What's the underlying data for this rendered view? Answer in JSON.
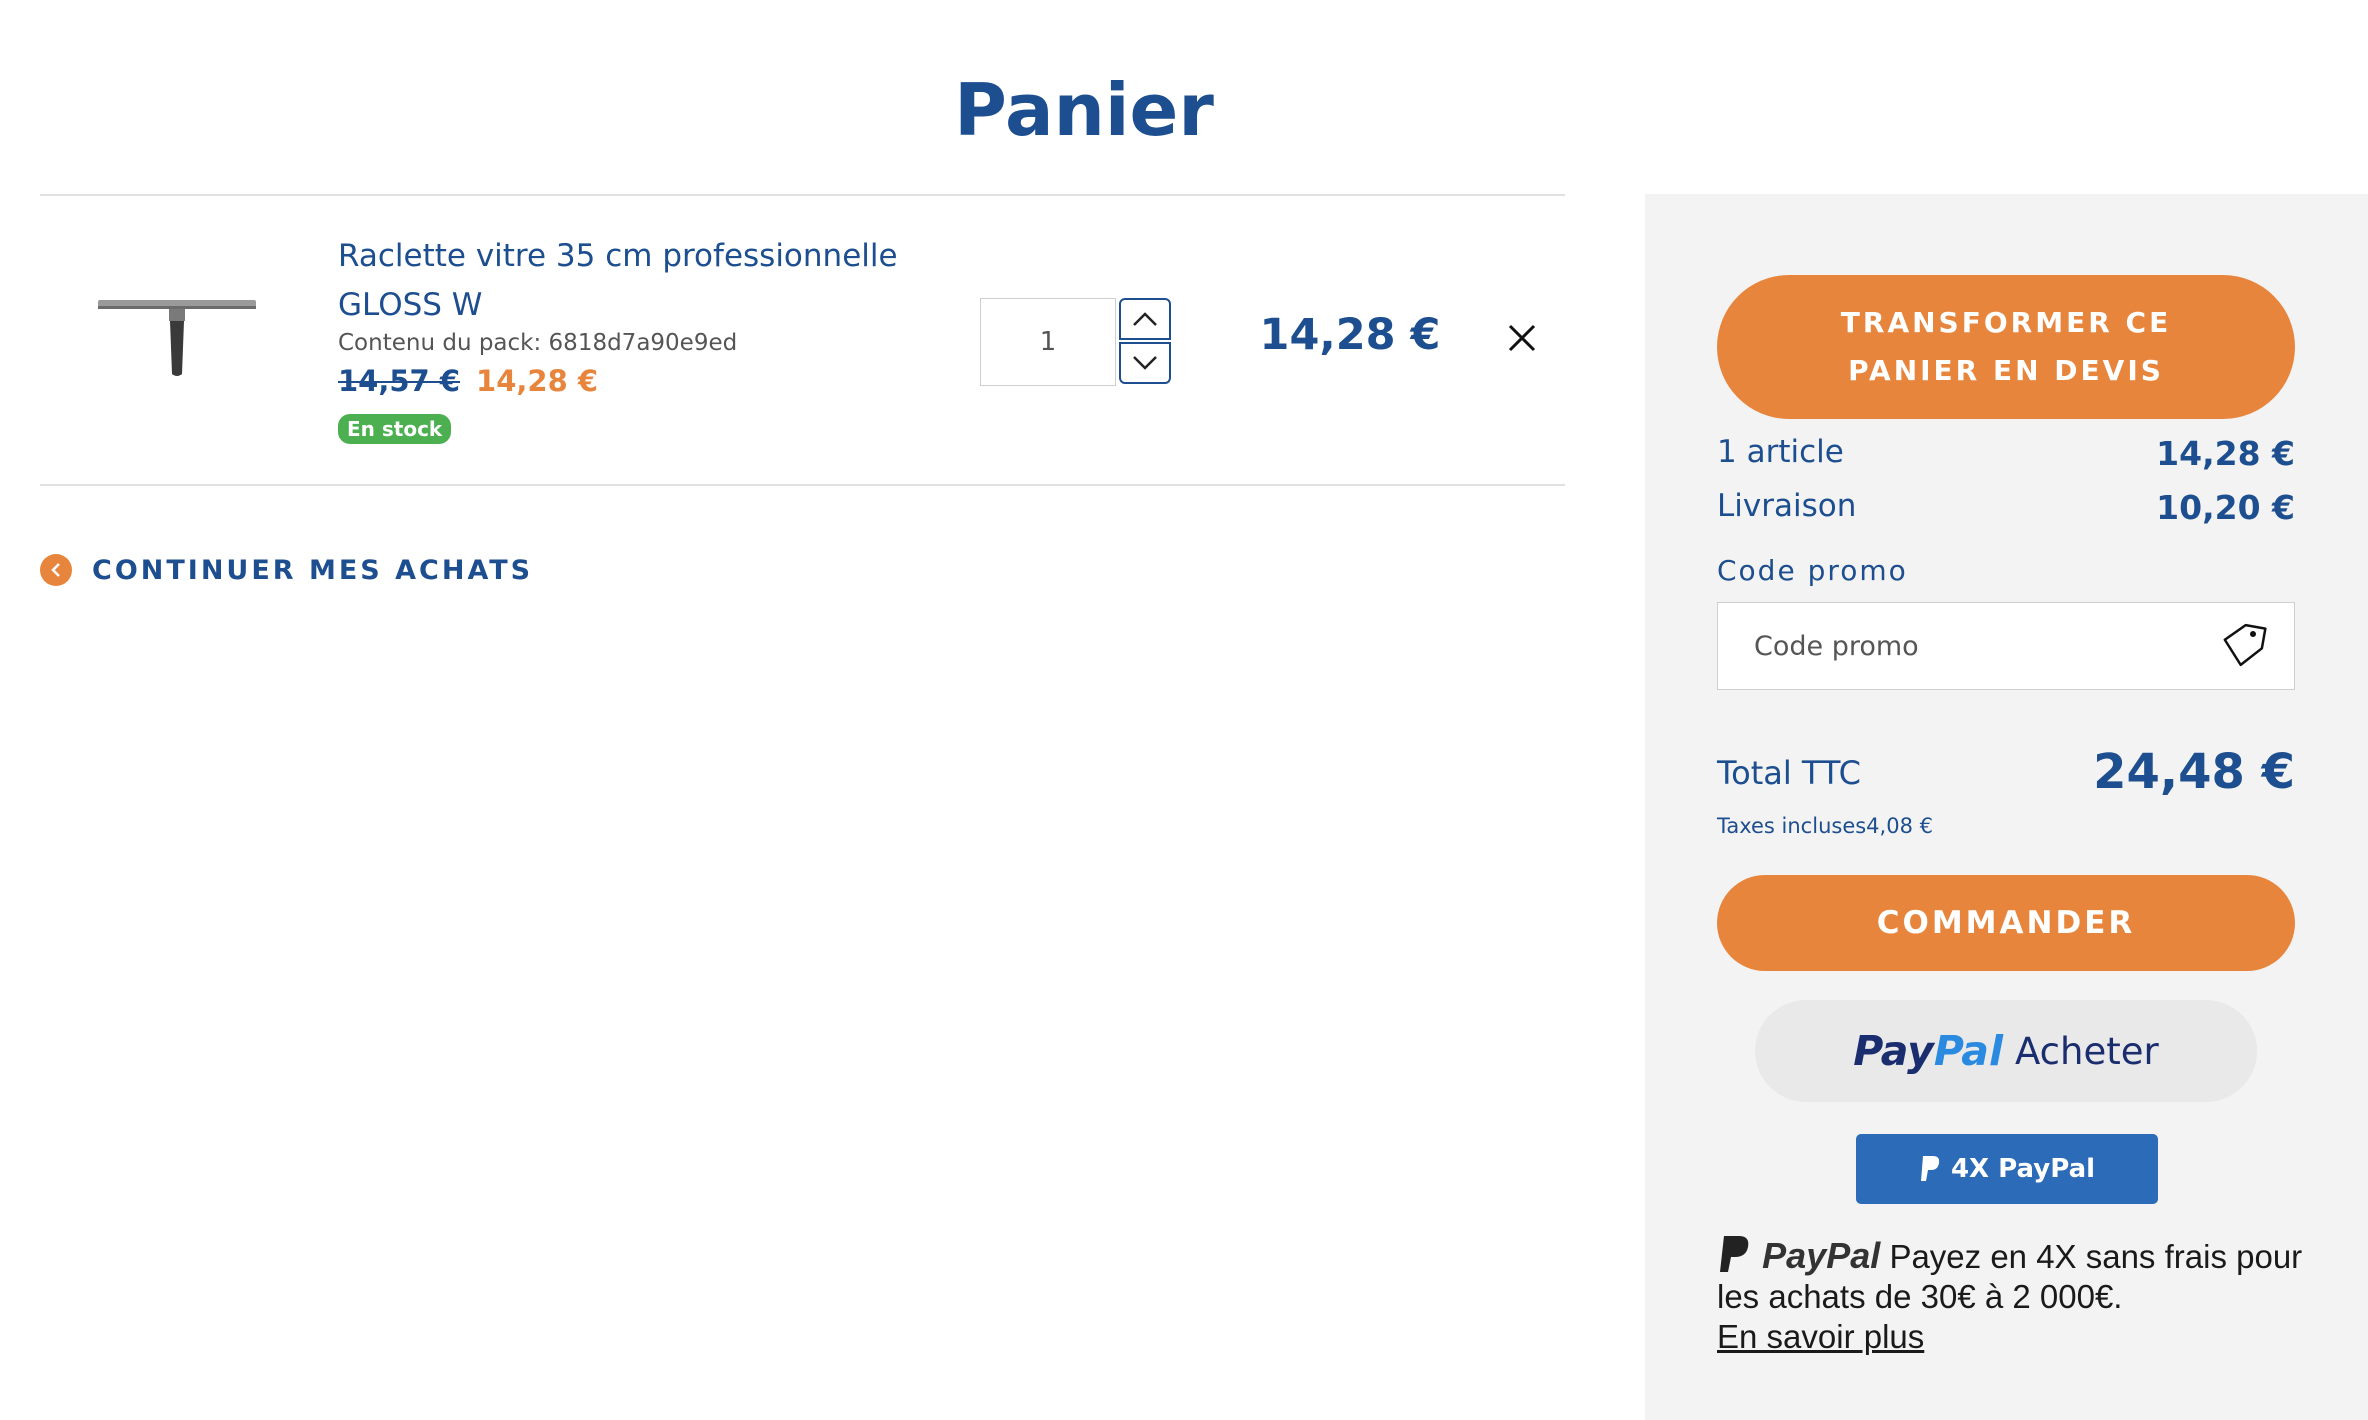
{
  "page": {
    "title": "Panier"
  },
  "cart": {
    "item": {
      "name": "Raclette vitre 35 cm professionnelle GLOSS W",
      "pack_content": "Contenu du pack: 6818d7a90e9ed",
      "old_price": "14,57 €",
      "price": "14,28 €",
      "stock": "En stock",
      "quantity": "1",
      "line_total": "14,28 €"
    },
    "continue_label": "CONTINUER MES ACHATS"
  },
  "summary": {
    "quote_button": "TRANSFORMER CE PANIER EN DEVIS",
    "articles_label": "1 article",
    "articles_value": "14,28 €",
    "shipping_label": "Livraison",
    "shipping_value": "10,20 €",
    "promo_label": "Code promo",
    "promo_placeholder": "Code promo",
    "total_label": "Total TTC",
    "total_value": "24,48 €",
    "tax_note": "Taxes incluses4,08 €",
    "order_button": "COMMANDER",
    "paypal_pay": "Pay",
    "paypal_pal": "Pal",
    "paypal_buy": "Acheter",
    "paypal_4x": "4X PayPal",
    "paypal_msg_logo": "PayPal",
    "paypal_msg_text": "Payez en 4X sans frais pour les achats de 30€ à 2 000€.",
    "paypal_learn_more": "En savoir plus"
  },
  "colors": {
    "brand_blue": "#1d4e8f",
    "accent_orange": "#e8853d",
    "stock_green": "#4caf50",
    "paypal_blue": "#2b6bb7"
  },
  "icons": [
    "chevron-up-icon",
    "chevron-down-icon",
    "close-icon",
    "chevron-left-icon",
    "tag-icon",
    "paypal-icon"
  ]
}
